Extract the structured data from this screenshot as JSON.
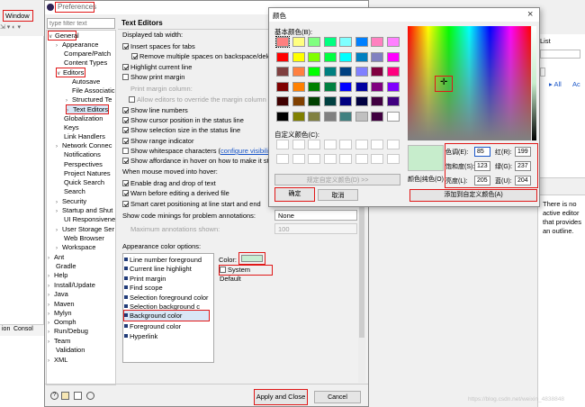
{
  "bg": {
    "window_tab": "Window",
    "side_label": "ion",
    "console": "Consol",
    "list_label": "List",
    "all_link": "All",
    "ac_link": "Ac",
    "outline_text": "There is no active editor that provides an outline."
  },
  "prefs": {
    "title": "Preferences",
    "filter_placeholder": "type filter text",
    "page_title": "Text Editors",
    "tree": [
      "General",
      "Appearance",
      "Compare/Patch",
      "Content Types",
      "Editors",
      "Autosave",
      "File Associatic",
      "Structured Te",
      "Text Editors",
      "Globalization",
      "Keys",
      "Link Handlers",
      "Network Connec",
      "Notifications",
      "Perspectives",
      "Project Natures",
      "Quick Search",
      "Search",
      "Security",
      "Startup and Shut",
      "UI Responsivene",
      "User Storage Ser",
      "Web Browser",
      "Workspace",
      "Ant",
      "Gradle",
      "Help",
      "Install/Update",
      "Java",
      "Maven",
      "Mylyn",
      "Oomph",
      "Run/Debug",
      "Team",
      "Validation",
      "XML"
    ],
    "opts": [
      "Displayed tab width:",
      "Insert spaces for tabs",
      "Remove multiple spaces on backspace/delete",
      "Highlight current line",
      "Show print margin",
      "Print margin column:",
      "Allow editors to override the margin column",
      "Show line numbers",
      "Show cursor position in the status line",
      "Show selection size in the status line",
      "Show range indicator",
      "Show whitespace characters (",
      "configure visibility",
      "Show affordance in hover on how to make it sticky",
      "When mouse moved into hover:",
      "Enable drag and drop of text",
      "Warn before editing a derived file",
      "Smart caret positioning at line start and end",
      "Show code minings for problem annotations:",
      "None",
      "Maximum annotations shown:",
      "100",
      "Appearance color options:"
    ],
    "colors": [
      "Line number foreground",
      "Current line highlight",
      "Print margin",
      "Find scope",
      "Selection foreground color",
      "Selection background c",
      "Background color",
      "Foreground color",
      "Hyperlink"
    ],
    "color_label": "Color:",
    "system_default": "System Default",
    "apply_close": "Apply and Close",
    "cancel": "Cancel",
    "swatch": "#c7eed2"
  },
  "picker": {
    "title": "颜色",
    "basic_label": "基本颜色(B):",
    "custom_label": "自定义颜色(C):",
    "define_btn": "规定自定义颜色(D) >>",
    "ok": "确定",
    "cancel": "取消",
    "add_custom": "添加到自定义颜色(A)",
    "color_solid": "颜色|纯色(O)",
    "hue_label": "色调(E):",
    "hue": "85",
    "sat_label": "饱和度(S):",
    "sat": "123",
    "lum_label": "亮度(L):",
    "lum": "205",
    "red_label": "红(R):",
    "red": "199",
    "green_label": "绿(G):",
    "green": "237",
    "blue_label": "蓝(U):",
    "blue": "204",
    "preview": "#c7edcc",
    "close_icon": "×",
    "swatches": [
      "#ff8080",
      "#ffff80",
      "#80ff80",
      "#00ff80",
      "#80ffff",
      "#0080ff",
      "#ff80c0",
      "#ff80ff",
      "#ff0000",
      "#ffff00",
      "#80ff00",
      "#00ff40",
      "#00ffff",
      "#0080c0",
      "#8080c0",
      "#ff00ff",
      "#804040",
      "#ff8040",
      "#00ff00",
      "#008080",
      "#004080",
      "#8080ff",
      "#800040",
      "#ff0080",
      "#800000",
      "#ff8000",
      "#008000",
      "#008040",
      "#0000ff",
      "#0000a0",
      "#800080",
      "#8000ff",
      "#400000",
      "#804000",
      "#004000",
      "#004040",
      "#000080",
      "#000040",
      "#400040",
      "#400080",
      "#000000",
      "#808000",
      "#808040",
      "#808080",
      "#408080",
      "#c0c0c0",
      "#400040",
      "#ffffff"
    ]
  },
  "watermark": "https://blog.csdn.net/weixin_4838848"
}
